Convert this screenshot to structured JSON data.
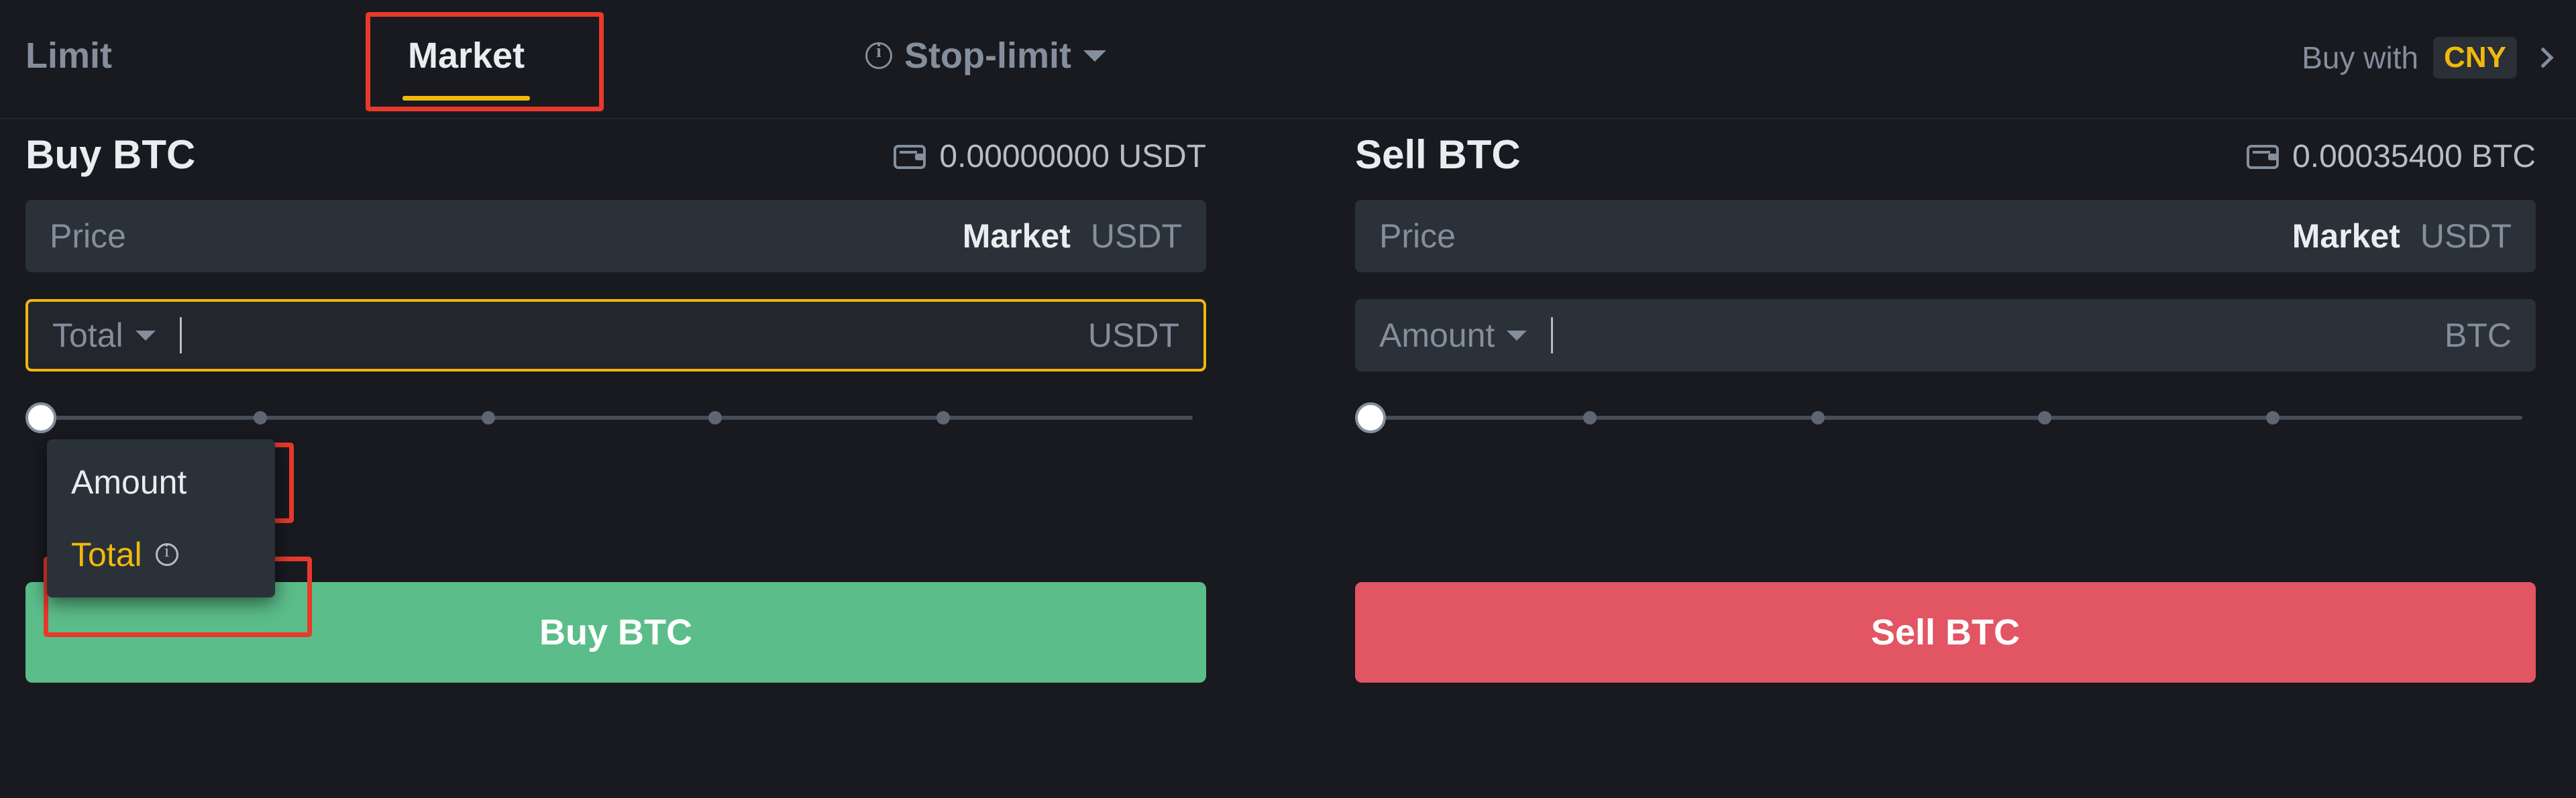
{
  "tabs": [
    {
      "label": "Limit",
      "active": false
    },
    {
      "label": "Market",
      "active": true
    },
    {
      "label": "Stop-limit",
      "active": false
    }
  ],
  "header": {
    "buy_with_label": "Buy with",
    "currency_badge": "CNY"
  },
  "buy_panel": {
    "title": "Buy BTC",
    "balance": "0.00000000 USDT",
    "price_label": "Price",
    "price_value": "Market",
    "price_unit": "USDT",
    "amount_label": "Total",
    "amount_value": "",
    "amount_unit": "USDT",
    "slider_percent": 0,
    "action_label": "Buy BTC"
  },
  "sell_panel": {
    "title": "Sell BTC",
    "balance": "0.00035400 BTC",
    "price_label": "Price",
    "price_value": "Market",
    "price_unit": "USDT",
    "amount_label": "Amount",
    "amount_value": "",
    "amount_unit": "BTC",
    "slider_percent": 0,
    "action_label": "Sell BTC"
  },
  "dropdown": {
    "items": [
      {
        "label": "Amount",
        "selected": false
      },
      {
        "label": "Total",
        "selected": true
      }
    ]
  },
  "colors": {
    "accent": "#f0b90b",
    "buy": "#5bbd8a",
    "sell": "#e25563",
    "highlight": "#e8392b",
    "background": "#181a20",
    "field": "#2b3139"
  }
}
